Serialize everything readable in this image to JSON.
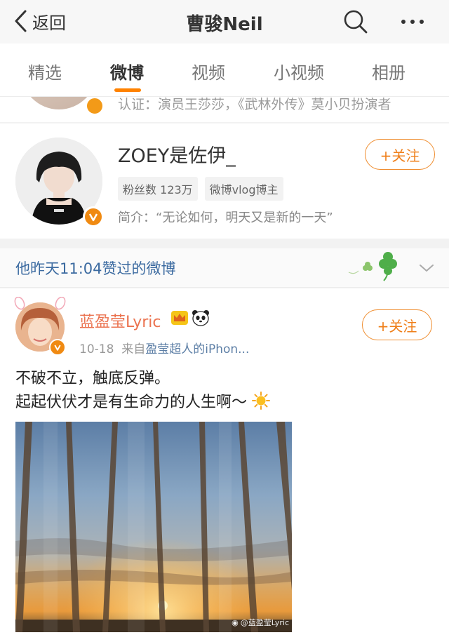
{
  "nav": {
    "back_label": "返回",
    "title": "曹骏Neil"
  },
  "tabs": [
    {
      "label": "精选"
    },
    {
      "label": "微博"
    },
    {
      "label": "视频"
    },
    {
      "label": "小视频"
    },
    {
      "label": "相册"
    }
  ],
  "active_tab": "微博",
  "prev_user": {
    "intro": "认证：演员王莎莎，《武林外传》莫小贝扮演者"
  },
  "zoey": {
    "name": "ZOEY是佐伊_",
    "fans_badge": "粉丝数 123万",
    "tag_badge": "微博vlog博主",
    "intro": "简介：“无论如何，明天又是新的一天”",
    "follow_label": "+关注"
  },
  "liked": {
    "text": "他昨天11:04赞过的微博"
  },
  "post": {
    "author": "蓝盈莹Lyric",
    "date": "10-18",
    "source_prefix": "来自",
    "source": "盈莹超人的iPhon...",
    "line1": "不破不立，触底反弹。",
    "line2": "起起伏伏才是有生命力的人生啊～",
    "follow_label": "+关注",
    "watermark": "@蓝盈莹Lyric"
  },
  "colors": {
    "accent_orange": "#ff8200",
    "link_blue": "#3b6aa0",
    "author_orange": "#eb7350"
  }
}
